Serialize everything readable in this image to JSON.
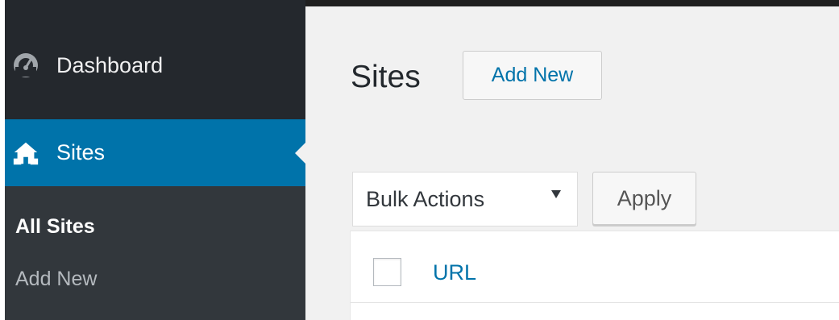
{
  "sidebar": {
    "items": [
      {
        "label": "Dashboard",
        "icon": "dashboard-icon"
      },
      {
        "label": "Sites",
        "icon": "sites-icon",
        "active": true
      }
    ],
    "submenu": [
      {
        "label": "All Sites",
        "current": true
      },
      {
        "label": "Add New"
      }
    ]
  },
  "main": {
    "title": "Sites",
    "add_new_label": "Add New",
    "bulk_actions": {
      "selected": "Bulk Actions"
    },
    "apply_label": "Apply",
    "table": {
      "columns": [
        "URL"
      ]
    }
  },
  "colors": {
    "sidebar_bg": "#24282d",
    "submenu_bg": "#32373c",
    "accent": "#0073aa",
    "content_bg": "#f1f1f1"
  }
}
